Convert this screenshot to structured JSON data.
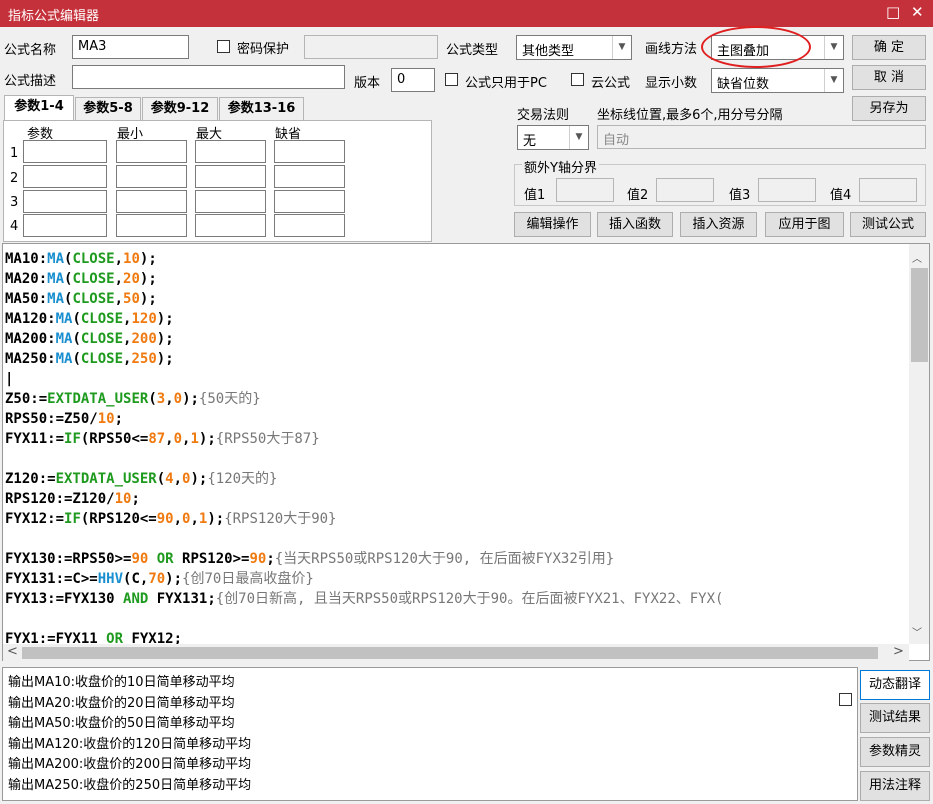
{
  "window": {
    "title": "指标公式编辑器",
    "minimize_glyph": "□",
    "close_glyph": "✕"
  },
  "header": {
    "name_label": "公式名称",
    "name_value": "MA3",
    "password_label": "密码保护",
    "type_label": "公式类型",
    "type_value": "其他类型",
    "draw_label": "画线方法",
    "draw_value": "主图叠加",
    "desc_label": "公式描述",
    "desc_value": "",
    "version_label": "版本",
    "version_value": "0",
    "pc_only_label": "公式只用于PC",
    "cloud_label": "云公式",
    "decimals_label": "显示小数",
    "decimals_value": "缺省位数",
    "ok_label": "确  定",
    "cancel_label": "取  消",
    "saveas_label": "另存为"
  },
  "tabs": [
    "参数1-4",
    "参数5-8",
    "参数9-12",
    "参数13-16"
  ],
  "params": {
    "headers": [
      "参数",
      "最小",
      "最大",
      "缺省"
    ],
    "rows": [
      "1",
      "2",
      "3",
      "4"
    ]
  },
  "trade": {
    "rule_label": "交易法则",
    "rule_value": "无",
    "axis_label": "坐标线位置,最多6个,用分号分隔",
    "axis_placeholder": "自动",
    "extra_y_label": "额外Y轴分界",
    "values": [
      "值1",
      "值2",
      "值3",
      "值4"
    ]
  },
  "toolbar": [
    "编辑操作",
    "插入函数",
    "插入资源",
    "应用于图",
    "测试公式"
  ],
  "code_lines": [
    [
      [
        "MA10:",
        ""
      ],
      [
        "MA",
        "f"
      ],
      [
        "(",
        ""
      ],
      [
        "CLOSE",
        "g"
      ],
      [
        ",",
        ""
      ],
      [
        "10",
        "n"
      ],
      [
        ");",
        ""
      ]
    ],
    [
      [
        "MA20:",
        ""
      ],
      [
        "MA",
        "f"
      ],
      [
        "(",
        ""
      ],
      [
        "CLOSE",
        "g"
      ],
      [
        ",",
        ""
      ],
      [
        "20",
        "n"
      ],
      [
        ");",
        ""
      ]
    ],
    [
      [
        "MA50:",
        ""
      ],
      [
        "MA",
        "f"
      ],
      [
        "(",
        ""
      ],
      [
        "CLOSE",
        "g"
      ],
      [
        ",",
        ""
      ],
      [
        "50",
        "n"
      ],
      [
        ");",
        ""
      ]
    ],
    [
      [
        "MA120:",
        ""
      ],
      [
        "MA",
        "f"
      ],
      [
        "(",
        ""
      ],
      [
        "CLOSE",
        "g"
      ],
      [
        ",",
        ""
      ],
      [
        "120",
        "n"
      ],
      [
        ");",
        ""
      ]
    ],
    [
      [
        "MA200:",
        ""
      ],
      [
        "MA",
        "f"
      ],
      [
        "(",
        ""
      ],
      [
        "CLOSE",
        "g"
      ],
      [
        ",",
        ""
      ],
      [
        "200",
        "n"
      ],
      [
        ");",
        ""
      ]
    ],
    [
      [
        "MA250:",
        ""
      ],
      [
        "MA",
        "f"
      ],
      [
        "(",
        ""
      ],
      [
        "CLOSE",
        "g"
      ],
      [
        ",",
        ""
      ],
      [
        "250",
        "n"
      ],
      [
        ");",
        ""
      ]
    ],
    [
      [
        "|",
        ""
      ]
    ],
    [
      [
        "Z50:=",
        ""
      ],
      [
        "EXTDATA_USER",
        "g"
      ],
      [
        "(",
        ""
      ],
      [
        "3",
        "n"
      ],
      [
        ",",
        ""
      ],
      [
        "0",
        "n"
      ],
      [
        ");",
        ""
      ],
      [
        "{50天的}",
        "cm"
      ]
    ],
    [
      [
        "RPS50:=Z50/",
        ""
      ],
      [
        "10",
        "n"
      ],
      [
        ";",
        ""
      ]
    ],
    [
      [
        "FYX11:=",
        ""
      ],
      [
        "IF",
        "g"
      ],
      [
        "(RPS50<=",
        ""
      ],
      [
        "87",
        "n"
      ],
      [
        ",",
        ""
      ],
      [
        "0",
        "n"
      ],
      [
        ",",
        ""
      ],
      [
        "1",
        "n"
      ],
      [
        ");",
        ""
      ],
      [
        "{RPS50大于87}",
        "cm"
      ]
    ],
    [
      [
        "",
        ""
      ]
    ],
    [
      [
        "Z120:=",
        ""
      ],
      [
        "EXTDATA_USER",
        "g"
      ],
      [
        "(",
        ""
      ],
      [
        "4",
        "n"
      ],
      [
        ",",
        ""
      ],
      [
        "0",
        "n"
      ],
      [
        ");",
        ""
      ],
      [
        "{120天的}",
        "cm"
      ]
    ],
    [
      [
        "RPS120:=Z120/",
        ""
      ],
      [
        "10",
        "n"
      ],
      [
        ";",
        ""
      ]
    ],
    [
      [
        "FYX12:=",
        ""
      ],
      [
        "IF",
        "g"
      ],
      [
        "(RPS120<=",
        ""
      ],
      [
        "90",
        "n"
      ],
      [
        ",",
        ""
      ],
      [
        "0",
        "n"
      ],
      [
        ",",
        ""
      ],
      [
        "1",
        "n"
      ],
      [
        ");",
        ""
      ],
      [
        "{RPS120大于90}",
        "cm"
      ]
    ],
    [
      [
        "",
        ""
      ]
    ],
    [
      [
        "FYX130:=RPS50>=",
        ""
      ],
      [
        "90",
        "n"
      ],
      [
        " ",
        ""
      ],
      [
        "OR",
        "kw"
      ],
      [
        " RPS120>=",
        ""
      ],
      [
        "90",
        "n"
      ],
      [
        ";",
        ""
      ],
      [
        "{当天RPS50或RPS120大于90, 在后面被FYX32引用}",
        "cm"
      ]
    ],
    [
      [
        "FYX131:=C>=",
        ""
      ],
      [
        "HHV",
        "f"
      ],
      [
        "(C,",
        ""
      ],
      [
        "70",
        "n"
      ],
      [
        ");",
        ""
      ],
      [
        "{创70日最高收盘价}",
        "cm"
      ]
    ],
    [
      [
        "FYX13:=FYX130 ",
        ""
      ],
      [
        "AND",
        "kw"
      ],
      [
        " FYX131;",
        ""
      ],
      [
        "{创70日新高, 且当天RPS50或RPS120大于90。在后面被FYX21、FYX22、FYX(",
        "cm"
      ]
    ],
    [
      [
        "",
        ""
      ]
    ],
    [
      [
        "FYX1:=FYX11 ",
        ""
      ],
      [
        "OR",
        "kw"
      ],
      [
        " FYX12;",
        ""
      ]
    ]
  ],
  "output_lines": [
    "输出MA10:收盘价的10日简单移动平均",
    "输出MA20:收盘价的20日简单移动平均",
    "输出MA50:收盘价的50日简单移动平均",
    "输出MA120:收盘价的120日简单移动平均",
    "输出MA200:收盘价的200日简单移动平均",
    "输出MA250:收盘价的250日简单移动平均"
  ],
  "side_buttons": [
    "动态翻译",
    "测试结果",
    "参数精灵",
    "用法注释"
  ],
  "colors": {
    "title_bg": "#c5313b",
    "func": "#1a8fd0",
    "const": "#1e9a1e",
    "number": "#f07a10",
    "comment": "#777777",
    "highlight_ring": "#e02020"
  }
}
